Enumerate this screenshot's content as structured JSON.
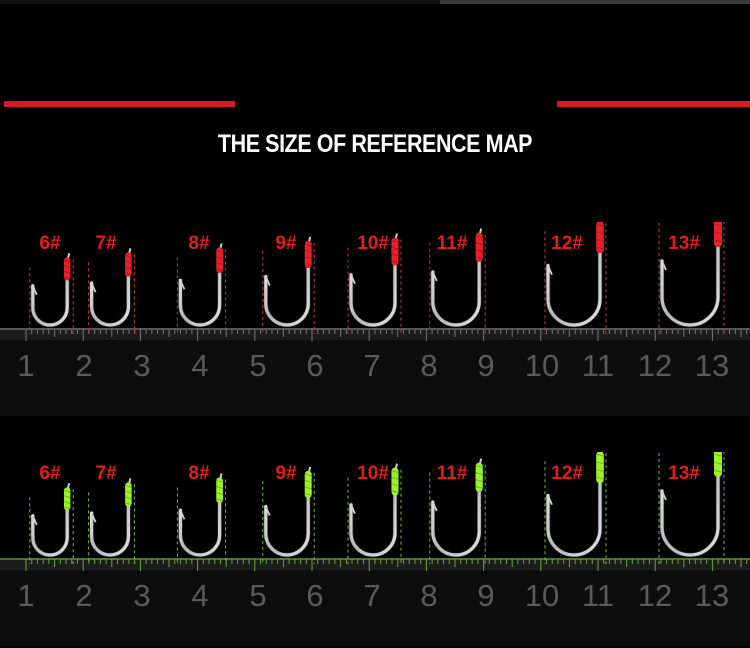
{
  "title": "THE SIZE OF REFERENCE MAP",
  "colors": {
    "accent_red": "#d71920",
    "label_red": "#e01e1e",
    "thread_red": "#e8202a",
    "thread_green": "#9cf22a"
  },
  "panels": [
    {
      "thread": "red",
      "hooks": [
        {
          "label": "6#",
          "size": 0.46
        },
        {
          "label": "7#",
          "size": 0.52
        },
        {
          "label": "8#",
          "size": 0.58
        },
        {
          "label": "9#",
          "size": 0.66
        },
        {
          "label": "10#",
          "size": 0.7
        },
        {
          "label": "11#",
          "size": 0.76
        },
        {
          "label": "12#",
          "size": 0.9
        },
        {
          "label": "13#",
          "size": 1.0
        }
      ],
      "ruler_numbers": [
        "1",
        "2",
        "3",
        "4",
        "5",
        "6",
        "7",
        "8",
        "9",
        "10",
        "11",
        "12",
        "13"
      ]
    },
    {
      "thread": "green",
      "hooks": [
        {
          "label": "6#",
          "size": 0.46
        },
        {
          "label": "7#",
          "size": 0.52
        },
        {
          "label": "8#",
          "size": 0.58
        },
        {
          "label": "9#",
          "size": 0.66
        },
        {
          "label": "10#",
          "size": 0.7
        },
        {
          "label": "11#",
          "size": 0.76
        },
        {
          "label": "12#",
          "size": 0.9
        },
        {
          "label": "13#",
          "size": 1.0
        }
      ],
      "ruler_numbers": [
        "1",
        "2",
        "3",
        "4",
        "5",
        "6",
        "7",
        "8",
        "9",
        "10",
        "11",
        "12",
        "13"
      ]
    }
  ]
}
